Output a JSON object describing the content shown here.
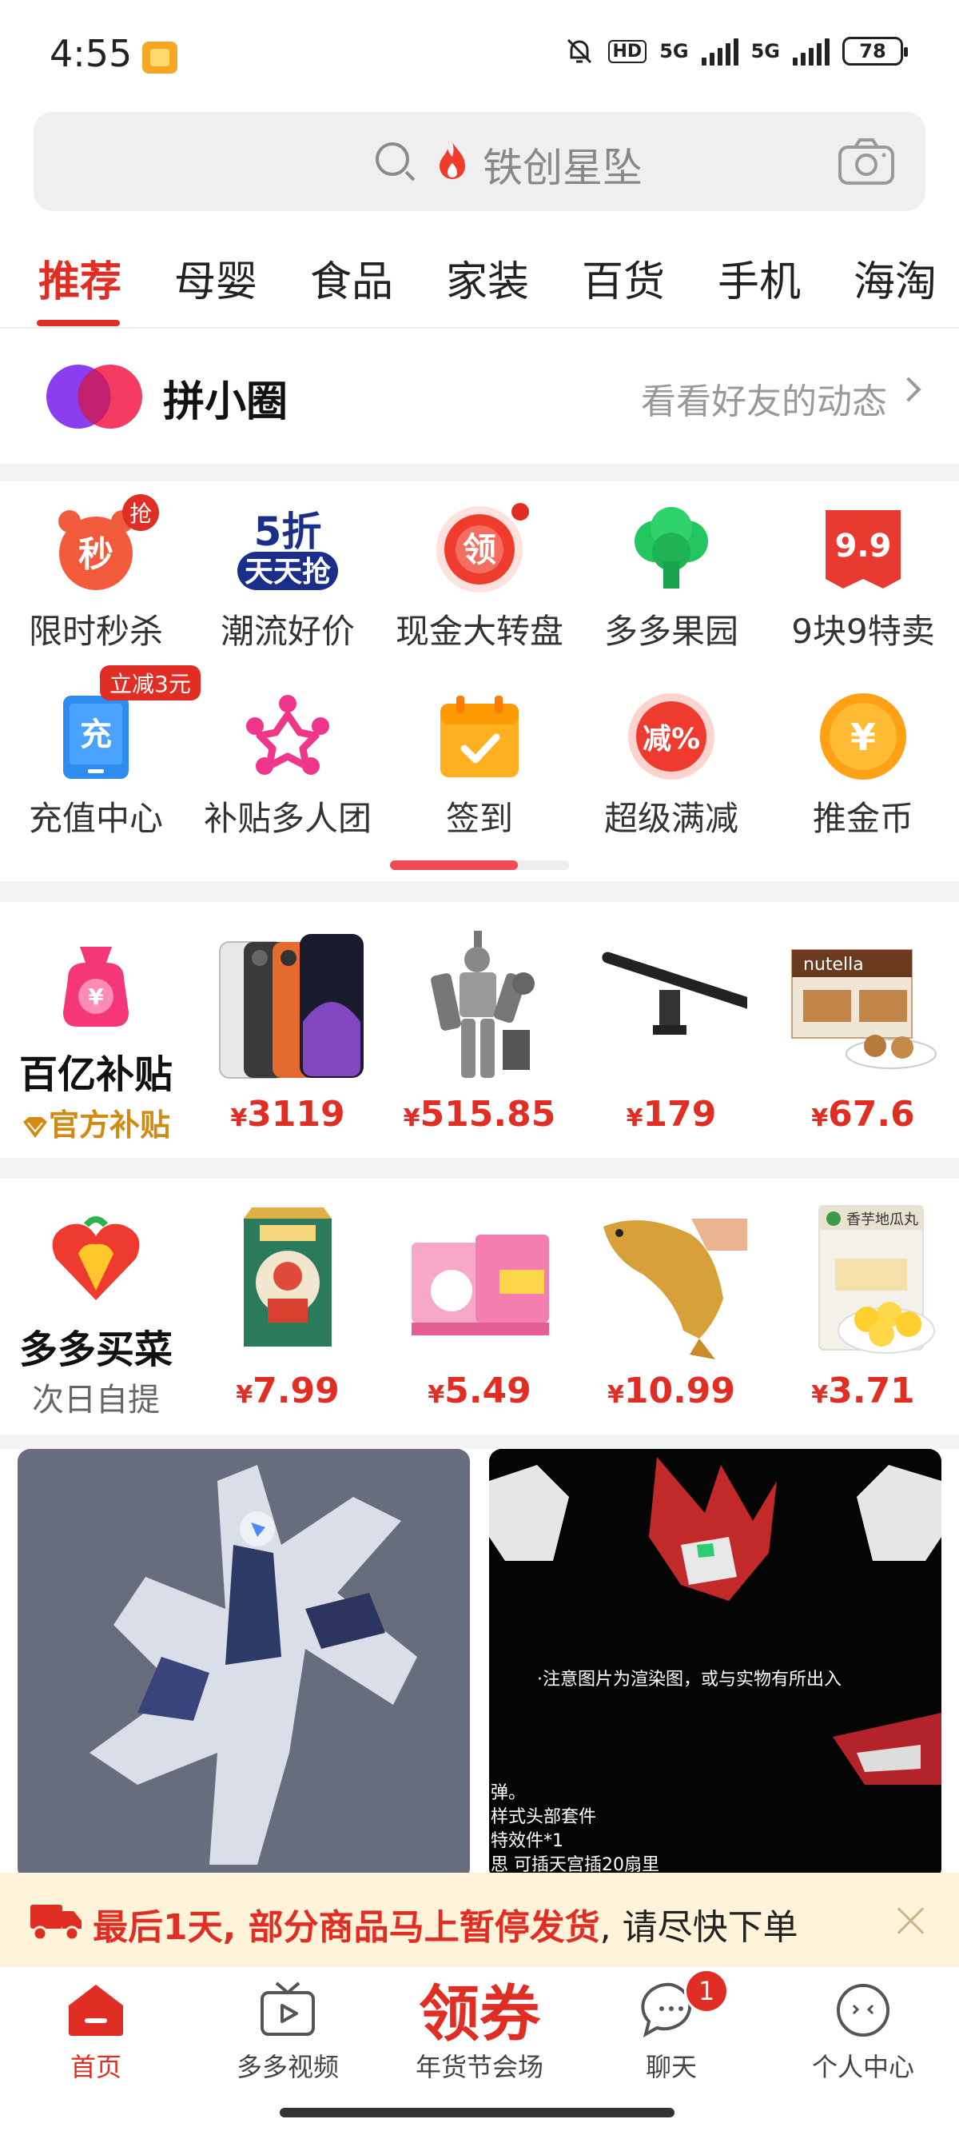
{
  "status_bar": {
    "time": "4:55",
    "hd": "HD",
    "net1": "5G",
    "net2": "5G",
    "battery": "78"
  },
  "search": {
    "hint": "铁创星坠",
    "icons": [
      "search-icon",
      "flame-icon",
      "camera-icon"
    ]
  },
  "tabs": [
    "推荐",
    "母婴",
    "食品",
    "家装",
    "百货",
    "手机",
    "海淘"
  ],
  "circle": {
    "title": "拼小圈",
    "link": "看看好友的动态"
  },
  "features": [
    {
      "label": "限时秒杀",
      "icon": "alarm-clock-icon",
      "icon_text": "秒",
      "badge": "抢"
    },
    {
      "label": "潮流好价",
      "icon": "sale-5-off-icon",
      "icon_text": "5折",
      "icon_sub": "天天抢"
    },
    {
      "label": "现金大转盘",
      "icon": "lucky-wheel-icon",
      "icon_text": "领",
      "dot": true
    },
    {
      "label": "多多果园",
      "icon": "tree-icon"
    },
    {
      "label": "9块9特卖",
      "icon": "price-tag-icon",
      "icon_text": "9.9"
    },
    {
      "label": "充值中心",
      "icon": "phone-recharge-icon",
      "icon_text": "充",
      "badge": "立减3元"
    },
    {
      "label": "补贴多人团",
      "icon": "group-people-icon"
    },
    {
      "label": "签到",
      "icon": "calendar-check-icon"
    },
    {
      "label": "超级满减",
      "icon": "discount-icon",
      "icon_text": "减%"
    },
    {
      "label": "推金币",
      "icon": "gold-coin-icon",
      "icon_text": "¥"
    }
  ],
  "subsidy": {
    "title": "百亿补贴",
    "subtitle": "官方补贴",
    "items": [
      {
        "name": "phone",
        "price": "3119"
      },
      {
        "name": "mecha-figure",
        "price": "515.85"
      },
      {
        "name": "screen-light-bar",
        "price": "179"
      },
      {
        "name": "nutella-snack",
        "price": "67.6"
      }
    ]
  },
  "grocery": {
    "title": "多多买菜",
    "subtitle": "次日自提",
    "items": [
      {
        "name": "gift-box",
        "price": "7.99"
      },
      {
        "name": "yogurt-drink",
        "price": "5.49"
      },
      {
        "name": "yellow-croaker",
        "price": "10.99",
        "price_alt": "10.99"
      },
      {
        "name": "taro-balls",
        "price": "3.71",
        "pkg_text": "香芋地瓜丸"
      }
    ]
  },
  "feed": {
    "card2_caption": "·注意图片为渲染图，或与实物有所出入",
    "card2_lines": [
      "弹。",
      "样式头部套件",
      "特效件*1",
      "思 可插天宫插20扇里"
    ]
  },
  "notice": {
    "highlight": "最后1天, 部分商品马上暂停发货",
    "rest": ", 请尽快下单"
  },
  "nav": [
    {
      "label": "首页",
      "icon": "home-icon",
      "active": true
    },
    {
      "label": "多多视频",
      "icon": "video-tv-icon"
    },
    {
      "label": "年货节会场",
      "icon": "coupon-text",
      "big": "领券"
    },
    {
      "label": "聊天",
      "icon": "chat-bubble-icon",
      "badge": "1"
    },
    {
      "label": "个人中心",
      "icon": "profile-face-icon"
    }
  ],
  "colors": {
    "accent": "#e02e24",
    "notice_bg": "#fff4d9",
    "search_bg": "#efefef"
  }
}
